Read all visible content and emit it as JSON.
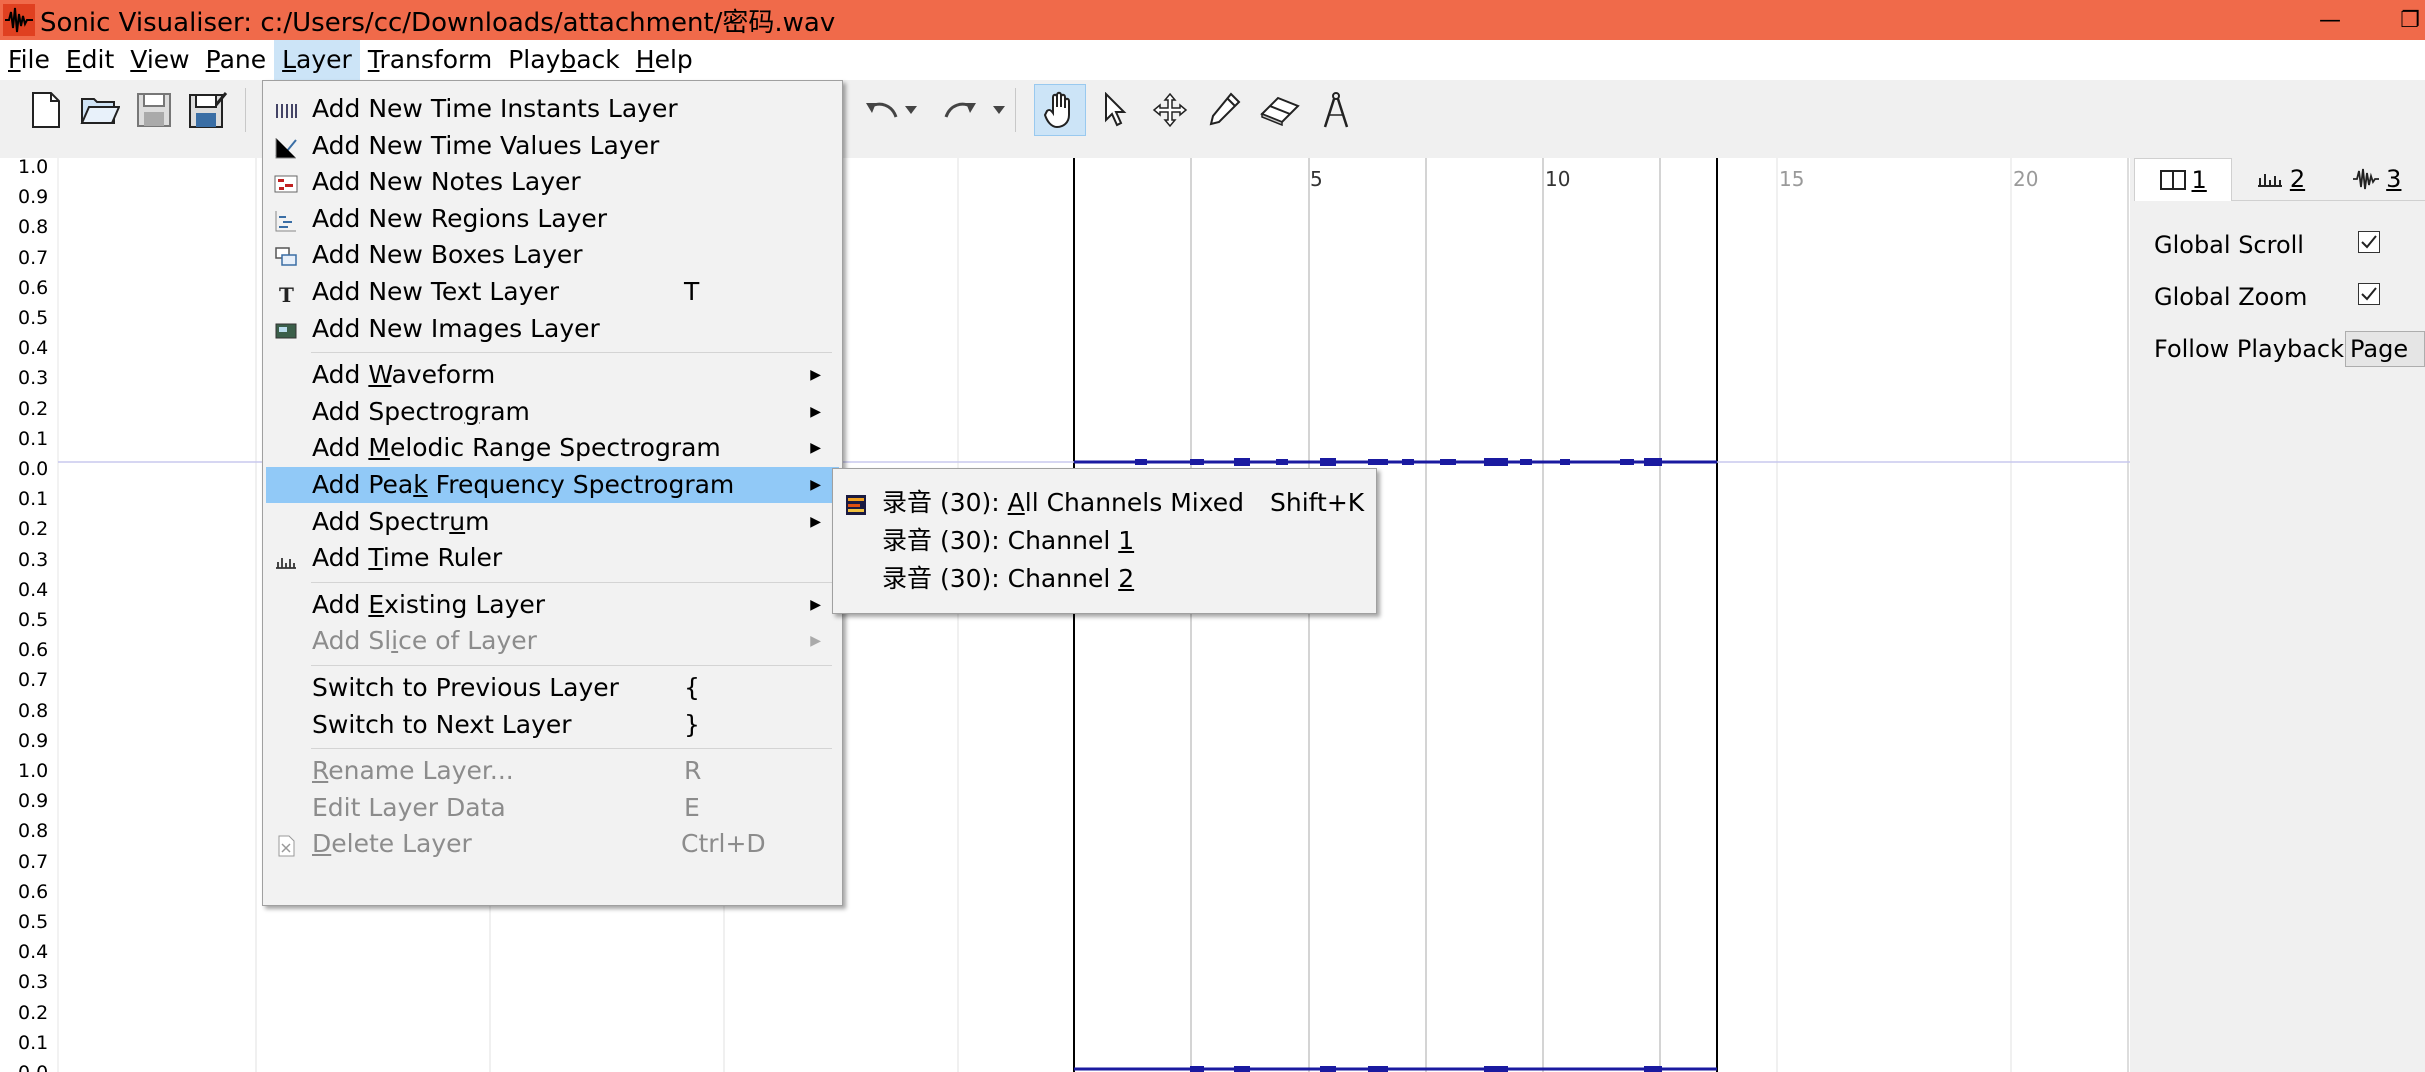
{
  "window": {
    "title": "Sonic Visualiser: c:/Users/cc/Downloads/attachment/密码.wav",
    "minimize": "—",
    "maximize": "❐"
  },
  "menubar": {
    "items": [
      {
        "pre": "",
        "u": "F",
        "post": "ile"
      },
      {
        "pre": "",
        "u": "E",
        "post": "dit"
      },
      {
        "pre": "",
        "u": "V",
        "post": "iew"
      },
      {
        "pre": "",
        "u": "P",
        "post": "ane"
      },
      {
        "pre": "",
        "u": "L",
        "post": "ayer"
      },
      {
        "pre": "",
        "u": "T",
        "post": "ransform"
      },
      {
        "pre": "Play",
        "u": "b",
        "post": "ack"
      },
      {
        "pre": "",
        "u": "H",
        "post": "elp"
      }
    ]
  },
  "layer_menu": {
    "items": [
      {
        "label": "Add New Time Instants Layer",
        "icon": "time-instants-icon"
      },
      {
        "label": "Add New Time Values Layer",
        "icon": "time-values-icon"
      },
      {
        "label": "Add New Notes Layer",
        "icon": "notes-icon"
      },
      {
        "label": "Add New Regions Layer",
        "icon": "regions-icon"
      },
      {
        "label": "Add New Boxes Layer",
        "icon": "boxes-icon"
      },
      {
        "label": "Add New Text Layer",
        "icon": "text-icon",
        "shortcut": "T"
      },
      {
        "label": "Add New Images Layer",
        "icon": "images-icon"
      },
      {
        "pre": "Add ",
        "u": "W",
        "post": "aveform",
        "submenu": true
      },
      {
        "pre": "Add Spectro",
        "u": "g",
        "post": "ram",
        "submenu": true
      },
      {
        "pre": "Add ",
        "u": "M",
        "post": "elodic Range Spectrogram",
        "submenu": true
      },
      {
        "pre": "Add Pea",
        "u": "k",
        "post": " Frequency Spectrogram",
        "submenu": true,
        "highlighted": true
      },
      {
        "pre": "Add Spectr",
        "u": "u",
        "post": "m",
        "submenu": true
      },
      {
        "pre": "Add ",
        "u": "T",
        "post": "ime Ruler",
        "icon": "time-ruler-icon"
      },
      {
        "pre": "Add ",
        "u": "E",
        "post": "xisting Layer",
        "submenu": true
      },
      {
        "pre": "Add Sl",
        "u": "i",
        "post": "ce of Layer",
        "submenu": true,
        "disabled": true
      },
      {
        "label": "Switch to Previous Layer",
        "shortcut": "{"
      },
      {
        "label": "Switch to Next Layer",
        "shortcut": "}"
      },
      {
        "pre": "",
        "u": "R",
        "post": "ename Layer...",
        "shortcut": "R",
        "disabled": true
      },
      {
        "label": "Edit Layer Data",
        "shortcut": "E",
        "disabled": true
      },
      {
        "pre": "",
        "u": "D",
        "post": "elete Layer",
        "shortcut": "Ctrl+D",
        "disabled": true,
        "icon": "delete-icon"
      }
    ]
  },
  "submenu": {
    "items": [
      {
        "pre": "录音 (30): ",
        "u": "A",
        "post": "ll Channels Mixed",
        "shortcut": "Shift+K",
        "icon": "spectrogram-icon"
      },
      {
        "pre": "录音 (30): Channel ",
        "u": "1",
        "post": ""
      },
      {
        "pre": "录音 (30): Channel ",
        "u": "2",
        "post": ""
      }
    ]
  },
  "ruler": {
    "ticks": [
      "5",
      "10",
      "15",
      "20"
    ]
  },
  "y_axis": {
    "labels": [
      "1.0",
      "0.9",
      "0.8",
      "0.7",
      "0.6",
      "0.5",
      "0.4",
      "0.3",
      "0.2",
      "0.1",
      "0.0",
      "0.1",
      "0.2",
      "0.3",
      "0.4",
      "0.5",
      "0.6",
      "0.7",
      "0.8",
      "0.9",
      "1.0",
      "0.9",
      "0.8",
      "0.7",
      "0.6",
      "0.5",
      "0.4",
      "0.3",
      "0.2",
      "0.1",
      "0.0"
    ]
  },
  "right_panel": {
    "tabs": [
      "1",
      "2",
      "3"
    ],
    "global_scroll": {
      "label": "Global Scroll",
      "checked": true
    },
    "global_zoom": {
      "label": "Global Zoom",
      "checked": true
    },
    "follow_playback": {
      "label": "Follow Playback",
      "value": "Page"
    }
  },
  "colors": {
    "titlebar": "#f06a4a",
    "highlight": "#91c9f7",
    "waveform": "#1a1aa0"
  }
}
